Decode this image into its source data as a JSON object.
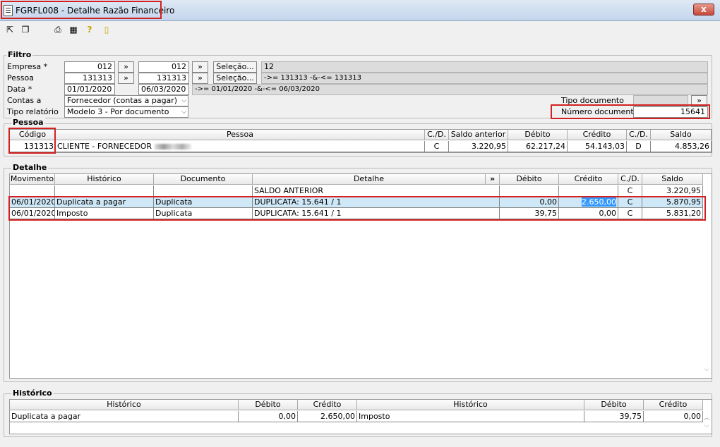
{
  "window": {
    "title": "FGRFL008 - Detalhe Razão Financeiro",
    "close_label": "x"
  },
  "toolbar": [
    {
      "icon": "export-icon"
    },
    {
      "icon": "windows-icon"
    },
    {
      "icon": "printer-icon"
    },
    {
      "icon": "calendar-icon"
    },
    {
      "icon": "help-icon"
    },
    {
      "icon": "exit-door-icon"
    }
  ],
  "filtro": {
    "group_label": "Filtro",
    "empresa": {
      "label": "Empresa *",
      "from": "012",
      "to": "012",
      "selection_label": "Seleção...",
      "summary": "12"
    },
    "pessoa": {
      "label": "Pessoa",
      "from": "131313",
      "to": "131313",
      "selection_label": "Seleção...",
      "summary": "->= 131313 -&-<= 131313"
    },
    "data": {
      "label": "Data *",
      "from": "01/01/2020",
      "to": "06/03/2020",
      "summary": "->= 01/01/2020 -&-<= 06/03/2020"
    },
    "contas": {
      "label": "Contas a",
      "value": "Fornecedor (contas a pagar)"
    },
    "tipo_relatorio": {
      "label": "Tipo relatório",
      "value": "Modelo 3 - Por documento"
    },
    "tipo_documento": {
      "label": "Tipo documento",
      "value": ""
    },
    "numero_documento": {
      "label": "Número documento",
      "value": "15641"
    },
    "range_button": "»"
  },
  "pessoa": {
    "group_label": "Pessoa",
    "columns": [
      "Código",
      "Pessoa",
      "C./D.",
      "Saldo anterior",
      "Débito",
      "Crédito",
      "C./D.",
      "Saldo"
    ],
    "row": {
      "codigo": "131313",
      "pessoa": "CLIENTE - FORNECEDOR",
      "cd1": "C",
      "saldo_anterior": "3.220,95",
      "debito": "62.217,24",
      "credito": "54.143,03",
      "cd2": "D",
      "saldo": "4.853,26"
    }
  },
  "detalhe": {
    "group_label": "Detalhe",
    "columns": [
      "Movimento",
      "Histórico",
      "Documento",
      "Detalhe",
      "»",
      "Débito",
      "Crédito",
      "C./D.",
      "Saldo"
    ],
    "rows": [
      {
        "movimento": "",
        "historico": "",
        "documento": "",
        "detalhe": "SALDO ANTERIOR",
        "debito": "",
        "credito": "",
        "cd": "C",
        "saldo": "3.220,95"
      },
      {
        "movimento": "06/01/2020",
        "historico": "Duplicata a pagar",
        "documento": "Duplicata",
        "detalhe": "DUPLICATA: 15.641 / 1",
        "debito": "0,00",
        "credito": "2.650,00",
        "cd": "C",
        "saldo": "5.870,95"
      },
      {
        "movimento": "06/01/2020",
        "historico": "Imposto",
        "documento": "Duplicata",
        "detalhe": "DUPLICATA: 15.641 / 1",
        "debito": "39,75",
        "credito": "0,00",
        "cd": "C",
        "saldo": "5.831,20"
      }
    ]
  },
  "historico": {
    "group_label": "Histórico",
    "columns": [
      "Histórico",
      "Débito",
      "Crédito",
      "Histórico",
      "Débito",
      "Crédito"
    ],
    "row": {
      "h1": "Duplicata a pagar",
      "d1": "0,00",
      "c1": "2.650,00",
      "h2": "Imposto",
      "d2": "39,75",
      "c2": "0,00"
    }
  },
  "colors": {
    "highlight_border": "#d32020",
    "selection": "#3399ff",
    "row_selected": "#cfe8f7"
  }
}
